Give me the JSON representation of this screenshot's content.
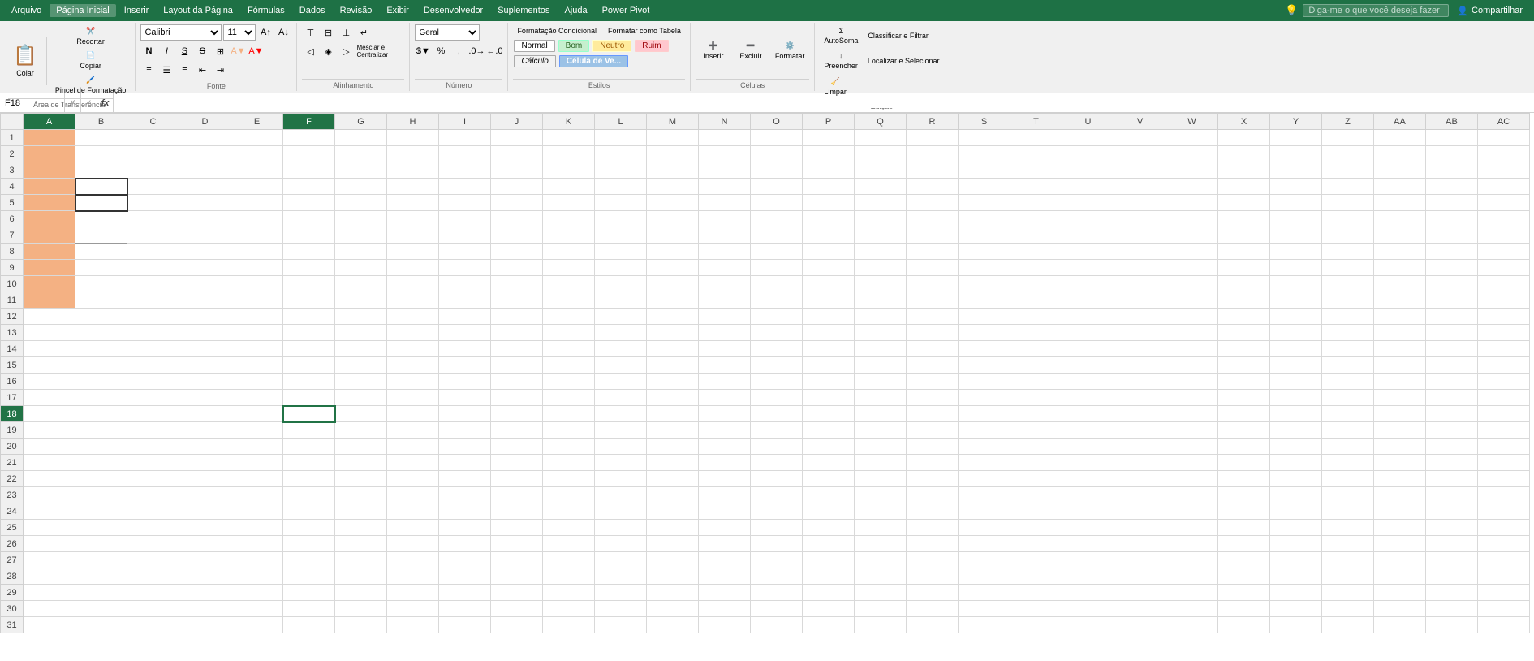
{
  "menu": {
    "items": [
      {
        "label": "Arquivo",
        "active": false
      },
      {
        "label": "Página Inicial",
        "active": true
      },
      {
        "label": "Inserir",
        "active": false
      },
      {
        "label": "Layout da Página",
        "active": false
      },
      {
        "label": "Fórmulas",
        "active": false
      },
      {
        "label": "Dados",
        "active": false
      },
      {
        "label": "Revisão",
        "active": false
      },
      {
        "label": "Exibir",
        "active": false
      },
      {
        "label": "Desenvolvedor",
        "active": false
      },
      {
        "label": "Suplementos",
        "active": false
      },
      {
        "label": "Ajuda",
        "active": false
      },
      {
        "label": "Power Pivot",
        "active": false
      }
    ],
    "search_placeholder": "Diga-me o que você deseja fazer",
    "share_label": "Compartilhar"
  },
  "ribbon": {
    "groups": {
      "clipboard": {
        "label": "Área de Transferência",
        "paste": "Colar",
        "cut": "Recortar",
        "copy": "Copiar",
        "format_painter": "Pincel de Formatação"
      },
      "font": {
        "label": "Fonte",
        "font_name": "Calibri",
        "font_size": "11",
        "bold": "N",
        "italic": "I",
        "underline": "S",
        "strikethrough": "S̶"
      },
      "alignment": {
        "label": "Alinhamento",
        "wrap_text": "Quebrar Texto Automaticamente",
        "merge_center": "Mesclar e Centralizar"
      },
      "number": {
        "label": "Número",
        "format": "Geral"
      },
      "styles": {
        "label": "Estilos",
        "conditional": "Formatação Condicional",
        "format_table": "Formatar como Tabela",
        "normal": "Normal",
        "bom": "Bom",
        "neutro": "Neutro",
        "ruim": "Ruim",
        "calculo": "Cálculo",
        "celula_ve": "Célula de Ve..."
      },
      "cells": {
        "label": "Células",
        "insert": "Inserir",
        "delete": "Excluir",
        "format": "Formatar"
      },
      "editing": {
        "label": "Edição",
        "autosum": "AutoSoma",
        "fill": "Preencher",
        "clear": "Limpar",
        "sort_filter": "Classificar e Filtrar",
        "find_select": "Localizar e Selecionar"
      }
    }
  },
  "formula_bar": {
    "name_box": "F18",
    "cancel": "✕",
    "confirm": "✓",
    "formula_icon": "fx",
    "value": ""
  },
  "spreadsheet": {
    "columns": [
      "A",
      "B",
      "C",
      "D",
      "E",
      "F",
      "G",
      "H",
      "I",
      "J",
      "K",
      "L",
      "M",
      "N",
      "O",
      "P",
      "Q",
      "R",
      "S",
      "T",
      "U",
      "V",
      "W",
      "X",
      "Y",
      "Z",
      "AA",
      "AB",
      "AC"
    ],
    "active_cell": "F18",
    "active_row": 18,
    "active_col": "F"
  },
  "colors": {
    "excel_green": "#217346",
    "menu_green": "#1e7145",
    "ribbon_bg": "#f0f0f0",
    "orange_fill": "#f4b183",
    "active_cell_border": "#217346"
  }
}
